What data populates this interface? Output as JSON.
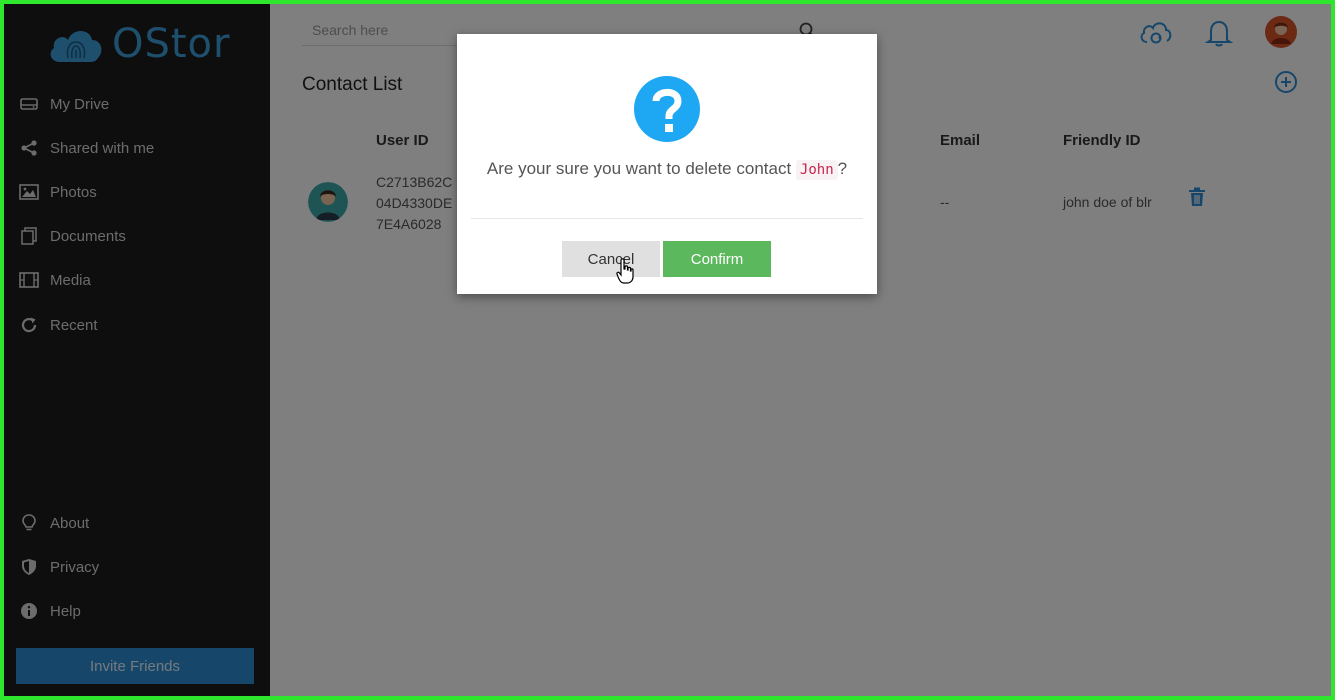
{
  "app": {
    "logo_text": "OStor",
    "brand_color": "#3d9fda"
  },
  "sidebar": {
    "items": [
      {
        "label": "My Drive",
        "icon": "drive-icon"
      },
      {
        "label": "Shared with me",
        "icon": "share-icon"
      },
      {
        "label": "Photos",
        "icon": "image-icon"
      },
      {
        "label": "Documents",
        "icon": "documents-icon"
      },
      {
        "label": "Media",
        "icon": "film-icon"
      },
      {
        "label": "Recent",
        "icon": "refresh-icon"
      }
    ],
    "bottom_items": [
      {
        "label": "About",
        "icon": "bulb-icon"
      },
      {
        "label": "Privacy",
        "icon": "shield-icon"
      },
      {
        "label": "Help",
        "icon": "info-icon"
      }
    ],
    "invite_label": "Invite Friends"
  },
  "header": {
    "search_placeholder": "Search here"
  },
  "contacts": {
    "title": "Contact List",
    "columns": {
      "user_id": "User ID",
      "email": "Email",
      "friendly_id": "Friendly ID"
    },
    "rows": [
      {
        "user_id_lines": [
          "C2713B62C",
          "04D4330DE",
          "7E4A6028"
        ],
        "email": "--",
        "friendly_id": "john doe of blr"
      }
    ]
  },
  "dialog": {
    "message_prefix": "Are your sure you want to delete contact",
    "contact_name": "John",
    "message_suffix": "?",
    "cancel_label": "Cancel",
    "confirm_label": "Confirm",
    "confirm_color": "#5cb85c",
    "icon_color": "#1ea7f2"
  }
}
